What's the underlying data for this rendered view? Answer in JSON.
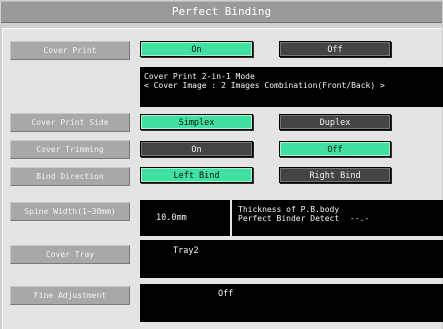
{
  "title": "Perfect Binding",
  "cover_print": {
    "label": "Cover Print",
    "on_label": "On",
    "off_label": "Off",
    "selected": "On",
    "mode_line1": "Cover Print 2-in-1 Mode",
    "mode_line2": "< Cover Image : 2 Images Combination(Front/Back) >"
  },
  "cover_print_side": {
    "label": "Cover Print Side",
    "simplex_label": "Simplex",
    "duplex_label": "Duplex",
    "selected": "Simplex"
  },
  "cover_trimming": {
    "label": "Cover Trimming",
    "on_label": "On",
    "off_label": "Off",
    "selected": "Off"
  },
  "bind_direction": {
    "label": "Bind Direction",
    "left_label": "Left Bind",
    "right_label": "Right Bind",
    "selected": "Left Bind"
  },
  "spine_width": {
    "label": "Spine Width(1~30mm)",
    "value": "10.0mm",
    "thickness_line1": "Thickness of P.B.body",
    "thickness_line2": "Perfect Binder Detect",
    "detect_value": "--.-"
  },
  "cover_tray": {
    "label": "Cover Tray",
    "value": "Tray2"
  },
  "fine_adjustment": {
    "label": "Fine Adjustment",
    "value": "Off"
  },
  "colors": {
    "selected": "#3fe0a0",
    "unselected": "#444444",
    "label_bg": "#a8a8a8",
    "info_bg": "#000000"
  }
}
